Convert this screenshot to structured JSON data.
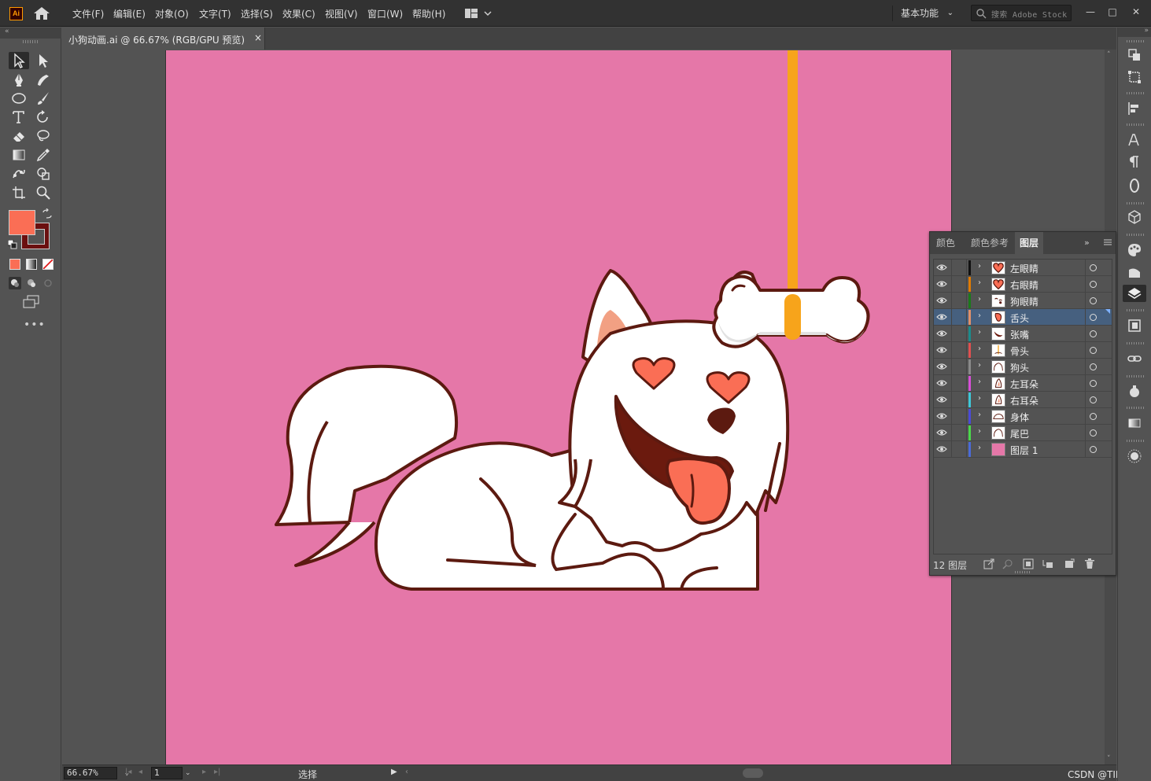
{
  "app": {
    "logo_text": "Ai",
    "menus": [
      "文件(F)",
      "编辑(E)",
      "对象(O)",
      "文字(T)",
      "选择(S)",
      "效果(C)",
      "视图(V)",
      "窗口(W)",
      "帮助(H)"
    ],
    "workspace": "基本功能",
    "stock_search_placeholder": "搜索 Adobe Stock",
    "window_buttons": {
      "minimize": "—",
      "maximize": "□",
      "close": "✕"
    }
  },
  "document": {
    "tab_title": "小狗动画.ai @ 66.67% (RGB/GPU 预览)",
    "close": "×"
  },
  "toolbar": {
    "fill_color": "#fa6e55",
    "stroke_color": "#6b0f0f",
    "more": "•••"
  },
  "status": {
    "zoom": "66.67%",
    "page": "1",
    "tool": "选择",
    "watermark": "CSDN @TING糖"
  },
  "layers_panel": {
    "tabs": [
      "颜色",
      "颜色参考",
      "图层"
    ],
    "active_tab": "图层",
    "layers": [
      {
        "name": "左眼睛",
        "color": "#111111",
        "thumb": "heart",
        "selected": false
      },
      {
        "name": "右眼睛",
        "color": "#e07b00",
        "thumb": "heart",
        "selected": false
      },
      {
        "name": "狗眼睛",
        "color": "#1a7a1a",
        "thumb": "eyes",
        "selected": false
      },
      {
        "name": "舌头",
        "color": "#e0906a",
        "thumb": "tongue",
        "selected": true
      },
      {
        "name": "张嘴",
        "color": "#1b8c8c",
        "thumb": "mouth",
        "selected": false
      },
      {
        "name": "骨头",
        "color": "#e05050",
        "thumb": "line",
        "selected": false
      },
      {
        "name": "狗头",
        "color": "#8a8a8a",
        "thumb": "outline",
        "selected": false
      },
      {
        "name": "左耳朵",
        "color": "#d84fd8",
        "thumb": "ear",
        "selected": false
      },
      {
        "name": "右耳朵",
        "color": "#3fc8d8",
        "thumb": "ear",
        "selected": false
      },
      {
        "name": "身体",
        "color": "#4b4bd8",
        "thumb": "body",
        "selected": false
      },
      {
        "name": "尾巴",
        "color": "#4bd84b",
        "thumb": "outline",
        "selected": false
      },
      {
        "name": "图层 1",
        "color": "#4b6bd8",
        "thumb": "pink",
        "selected": false
      }
    ],
    "count_label": "12 图层"
  },
  "artwork": {
    "artboard_color": "#e577a8",
    "fur": "#ffffff",
    "outline": "#5c1a10",
    "heart": "#fa6e55",
    "tongue": "#fa6e55",
    "mouth": "#6b1a0e",
    "rope": "#f7a41b",
    "bone_shade": "#e2e2e2"
  }
}
